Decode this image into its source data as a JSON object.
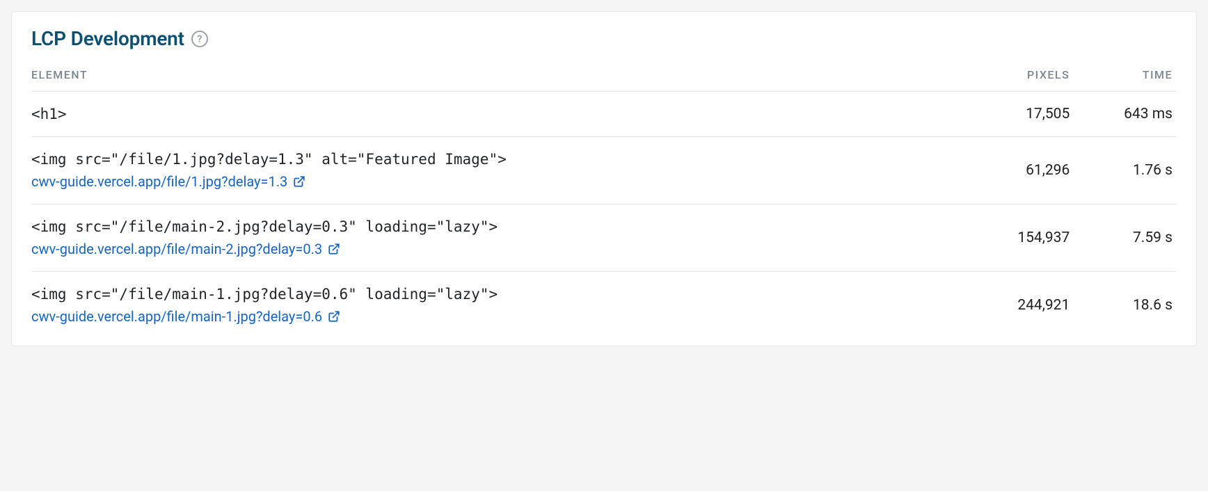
{
  "panel": {
    "title": "LCP Development"
  },
  "columns": {
    "element": "ELEMENT",
    "pixels": "PIXELS",
    "time": "TIME"
  },
  "rows": [
    {
      "element": "<h1>",
      "link": null,
      "pixels": "17,505",
      "time": "643 ms"
    },
    {
      "element": "<img src=\"/file/1.jpg?delay=1.3\" alt=\"Featured Image\">",
      "link": "cwv-guide.vercel.app/file/1.jpg?delay=1.3",
      "pixels": "61,296",
      "time": "1.76 s"
    },
    {
      "element": "<img src=\"/file/main-2.jpg?delay=0.3\" loading=\"lazy\">",
      "link": "cwv-guide.vercel.app/file/main-2.jpg?delay=0.3",
      "pixels": "154,937",
      "time": "7.59 s"
    },
    {
      "element": "<img src=\"/file/main-1.jpg?delay=0.6\" loading=\"lazy\">",
      "link": "cwv-guide.vercel.app/file/main-1.jpg?delay=0.6",
      "pixels": "244,921",
      "time": "18.6 s"
    }
  ]
}
